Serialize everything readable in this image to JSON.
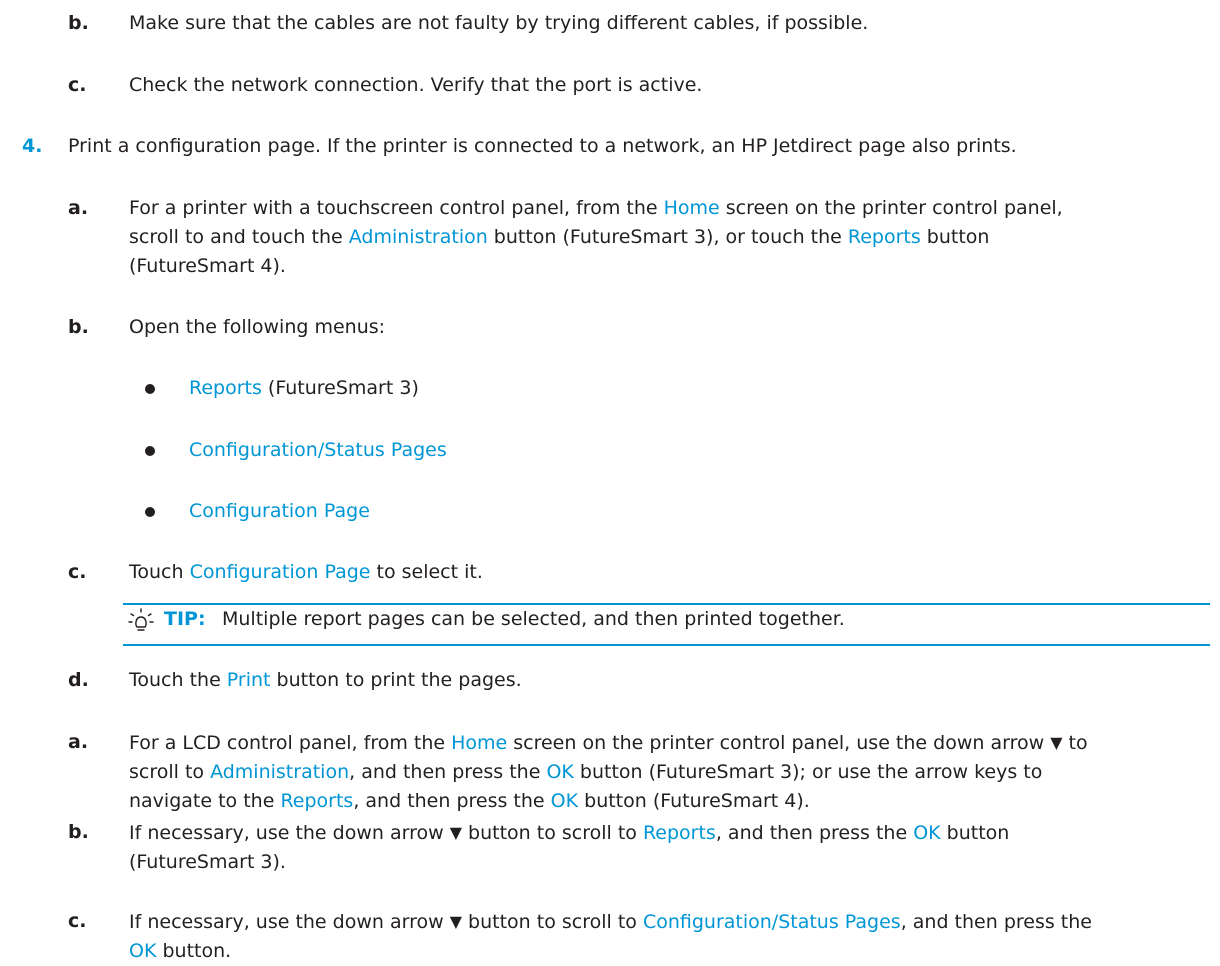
{
  "step3": {
    "b": {
      "marker": "b.",
      "text": "Make sure that the cables are not faulty by trying different cables, if possible."
    },
    "c": {
      "marker": "c.",
      "text": "Check the network connection. Verify that the port is active."
    }
  },
  "step4": {
    "number": "4.",
    "text": "Print a configuration page. If the printer is connected to a network, an HP Jetdirect page also prints.",
    "touch": {
      "a": {
        "marker": "a.",
        "l1_a": "For a printer with a touchscreen control panel, from the ",
        "l1_home": "Home",
        "l1_b": " screen on the printer control panel,",
        "l2_a": "scroll to and touch the ",
        "l2_admin": "Administration",
        "l2_b": " button (FutureSmart 3), or touch the ",
        "l2_reports": "Reports",
        "l2_c": " button",
        "l3": "(FutureSmart 4)."
      },
      "b": {
        "marker": "b.",
        "text": "Open the following menus:",
        "menus": [
          {
            "link": "Reports",
            "suffix": " (FutureSmart 3)"
          },
          {
            "link": "Configuration/Status Pages",
            "suffix": ""
          },
          {
            "link": "Configuration Page",
            "suffix": ""
          }
        ]
      },
      "c": {
        "marker": "c.",
        "pre": "Touch ",
        "link": "Configuration Page",
        "post": " to select it."
      },
      "tip": {
        "icon": "lightbulb-icon",
        "label": "TIP:",
        "text": "Multiple report pages can be selected, and then printed together."
      },
      "d": {
        "marker": "d.",
        "pre": "Touch the ",
        "link": "Print",
        "post": " button to print the pages."
      }
    },
    "lcd": {
      "a": {
        "marker": "a.",
        "l1_a": "For a LCD control panel, from the ",
        "l1_home": "Home",
        "l1_b": " screen on the printer control panel, use the down arrow ",
        "l1_arrow": "▼",
        "l1_c": " to",
        "l2_a": "scroll to ",
        "l2_admin": "Administration",
        "l2_b": ", and then press the ",
        "l2_ok": "OK",
        "l2_c": " button (FutureSmart 3); or use the arrow keys to",
        "l3_a": "navigate to the ",
        "l3_reports": "Reports",
        "l3_b": ", and then press the ",
        "l3_ok": "OK",
        "l3_c": " button (FutureSmart 4)."
      },
      "b": {
        "marker": "b.",
        "l1_a": "If necessary, use the down arrow ",
        "l1_arrow": "▼",
        "l1_b": " button to scroll to ",
        "l1_reports": "Reports",
        "l1_c": ", and then press the ",
        "l1_ok": "OK",
        "l1_d": " button",
        "l2": "(FutureSmart 3)."
      },
      "c": {
        "marker": "c.",
        "l1_a": "If necessary, use the down arrow ",
        "l1_arrow": "▼",
        "l1_b": " button to scroll to ",
        "l1_link": "Configuration/Status Pages",
        "l1_c": ", and then press the",
        "l2_ok": "OK",
        "l2_b": " button."
      }
    }
  },
  "colors": {
    "text": "#231f20",
    "link": "#0096d6"
  }
}
